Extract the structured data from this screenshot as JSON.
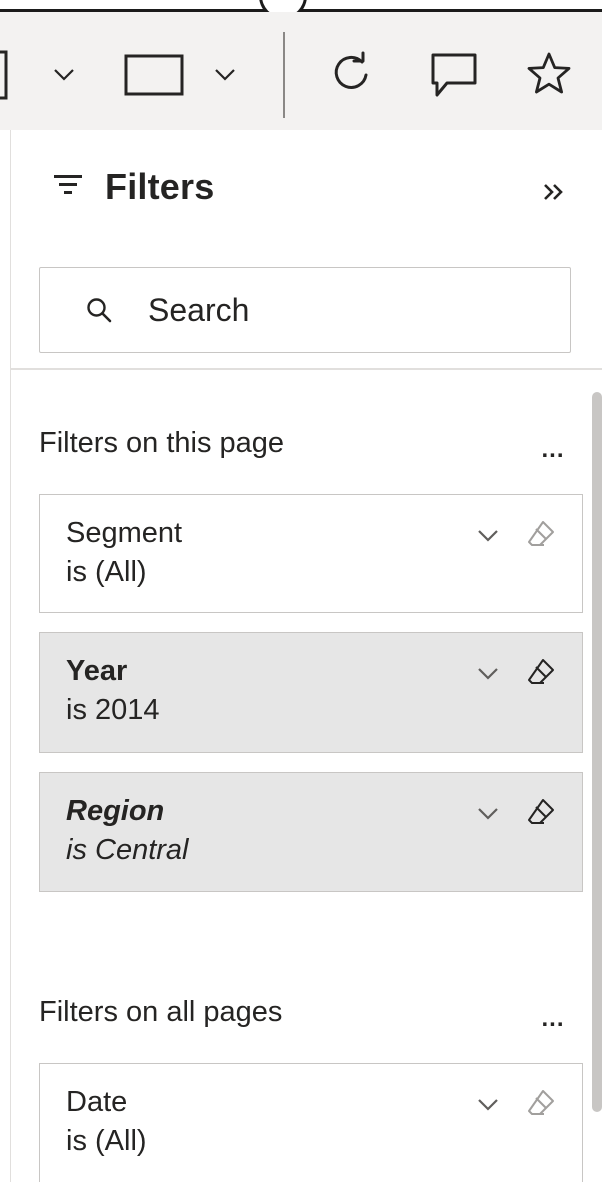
{
  "filter_pane": {
    "title": "Filters",
    "search_placeholder": "Search",
    "sections": [
      {
        "title": "Filters on this page",
        "more": "...",
        "cards": [
          {
            "name": "Segment",
            "value": "is (All)",
            "applied": false
          },
          {
            "name": "Year",
            "value": "is 2014",
            "applied": true
          },
          {
            "name": "Region",
            "value": "is Central",
            "applied": true
          }
        ]
      },
      {
        "title": "Filters on all pages",
        "more": "...",
        "cards": [
          {
            "name": "Date",
            "value": "is (All)",
            "applied": false
          }
        ]
      }
    ]
  },
  "icons": {
    "toolbar": [
      "chevron-down-icon",
      "rectangle-icon",
      "chevron-down-icon",
      "refresh-icon",
      "comment-icon",
      "star-icon"
    ],
    "pane": [
      "filter-icon",
      "collapse-icon",
      "search-icon",
      "chevron-down-icon",
      "eraser-icon"
    ]
  },
  "colors": {
    "toolbar_bg": "#f3f2f1",
    "applied_card_bg": "#e6e6e6",
    "text": "#252423",
    "icon": "#605e5c"
  }
}
